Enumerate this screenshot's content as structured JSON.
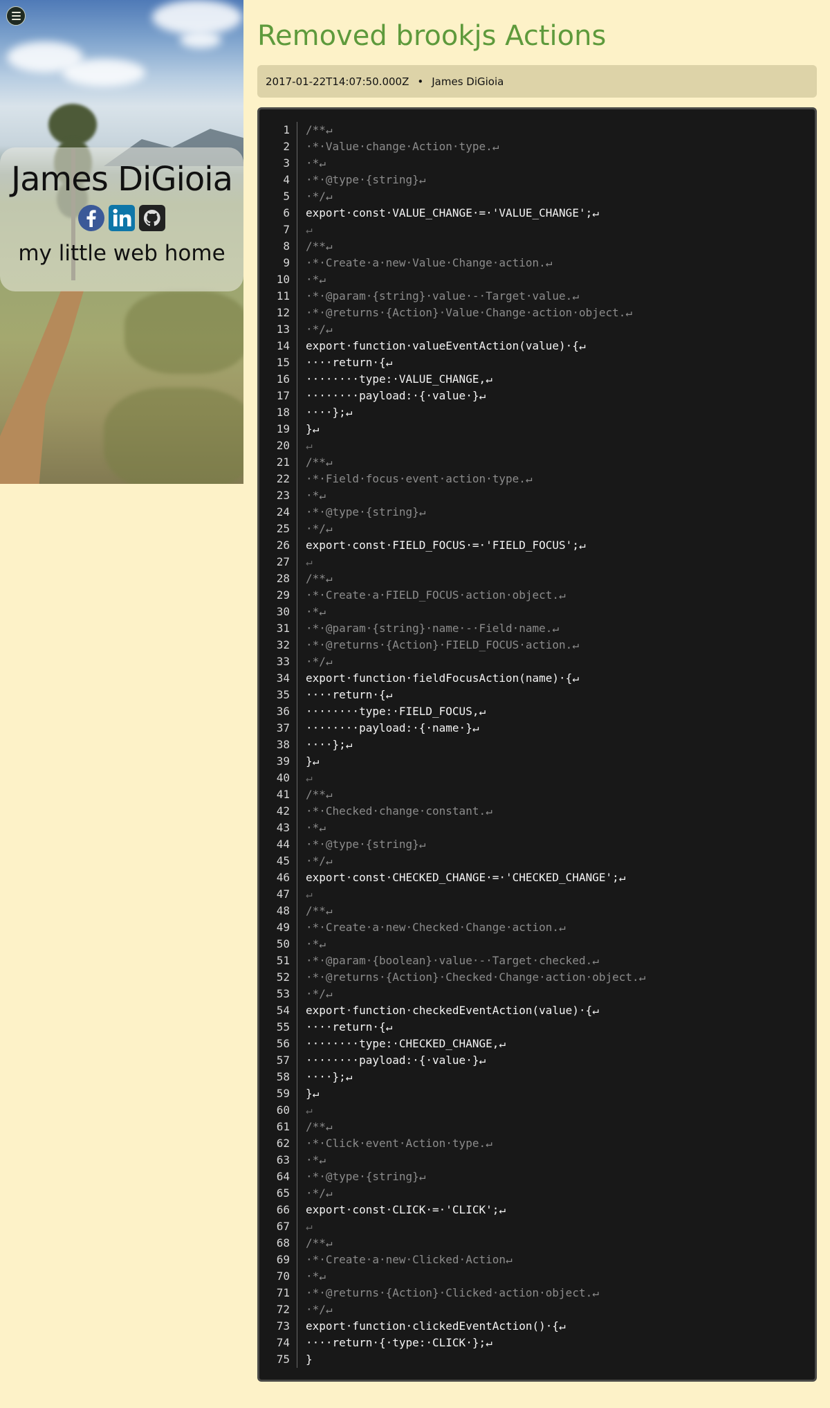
{
  "sidebar": {
    "name": "James DiGioia",
    "tagline": "my little web home",
    "social": [
      {
        "icon": "facebook-icon",
        "color": "#3b5998"
      },
      {
        "icon": "linkedin-icon",
        "color": "#0e76a8"
      },
      {
        "icon": "github-icon",
        "color": "#222222"
      }
    ]
  },
  "post": {
    "title": "Removed brookjs Actions",
    "date": "2017-01-22T14:07:50.000Z",
    "separator": "•",
    "author": "James DiGioia"
  },
  "code": {
    "lines": [
      "/**↵",
      "·*·Value·change·Action·type.↵",
      "·*↵",
      "·*·@type·{string}↵",
      "·*/↵",
      "export·const·VALUE_CHANGE·=·'VALUE_CHANGE';↵",
      "↵",
      "/**↵",
      "·*·Create·a·new·Value·Change·action.↵",
      "·*↵",
      "·*·@param·{string}·value·-·Target·value.↵",
      "·*·@returns·{Action}·Value·Change·action·object.↵",
      "·*/↵",
      "export·function·valueEventAction(value)·{↵",
      "····return·{↵",
      "········type:·VALUE_CHANGE,↵",
      "········payload:·{·value·}↵",
      "····};↵",
      "}↵",
      "↵",
      "/**↵",
      "·*·Field·focus·event·action·type.↵",
      "·*↵",
      "·*·@type·{string}↵",
      "·*/↵",
      "export·const·FIELD_FOCUS·=·'FIELD_FOCUS';↵",
      "↵",
      "/**↵",
      "·*·Create·a·FIELD_FOCUS·action·object.↵",
      "·*↵",
      "·*·@param·{string}·name·-·Field·name.↵",
      "·*·@returns·{Action}·FIELD_FOCUS·action.↵",
      "·*/↵",
      "export·function·fieldFocusAction(name)·{↵",
      "····return·{↵",
      "········type:·FIELD_FOCUS,↵",
      "········payload:·{·name·}↵",
      "····};↵",
      "}↵",
      "↵",
      "/**↵",
      "·*·Checked·change·constant.↵",
      "·*↵",
      "·*·@type·{string}↵",
      "·*/↵",
      "export·const·CHECKED_CHANGE·=·'CHECKED_CHANGE';↵",
      "↵",
      "/**↵",
      "·*·Create·a·new·Checked·Change·action.↵",
      "·*↵",
      "·*·@param·{boolean}·value·-·Target·checked.↵",
      "·*·@returns·{Action}·Checked·Change·action·object.↵",
      "·*/↵",
      "export·function·checkedEventAction(value)·{↵",
      "····return·{↵",
      "········type:·CHECKED_CHANGE,↵",
      "········payload:·{·value·}↵",
      "····};↵",
      "}↵",
      "↵",
      "/**↵",
      "·*·Click·event·Action·type.↵",
      "·*↵",
      "·*·@type·{string}↵",
      "·*/↵",
      "export·const·CLICK·=·'CLICK';↵",
      "↵",
      "/**↵",
      "·*·Create·a·new·Clicked·Action↵",
      "·*↵",
      "·*·@returns·{Action}·Clicked·action·object.↵",
      "·*/↵",
      "export·function·clickedEventAction()·{↵",
      "····return·{·type:·CLICK·};↵",
      "}"
    ]
  },
  "colors": {
    "page_bg": "#fdf2c8",
    "title": "#5e9a3c",
    "meta_bg": "#ddd3a8",
    "code_bg": "#181818"
  }
}
